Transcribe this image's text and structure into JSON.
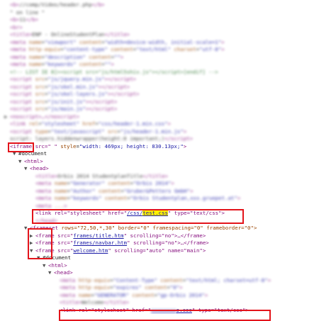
{
  "iframe": {
    "open": "<iframe src=\"",
    "src": "                         ",
    "style": "width: 469px; height: 830.13px;",
    "close": ">"
  },
  "document_label": "#document",
  "html_label": "<html>",
  "head_label": "<head>",
  "link1": {
    "prefix": "<link rel=\"stylesheet\" href=\"",
    "href_dir": "/css/",
    "href_file": "test.css",
    "suffix": "\" type=\"text/css\">"
  },
  "frameset": {
    "open": "frameset",
    "attrs": "rows=\"72,50,*,30\" border=\"0\" framespacing=\"0\" frameborder=\"0\">"
  },
  "frames": [
    {
      "prefix": "<frame src=\"",
      "href": "frames/title.htm",
      "suffix": "\" scrolling=\"no\">…</frame>"
    },
    {
      "prefix": "<frame src=\"",
      "href": "frames/navbar.htm",
      "suffix": "\" scrolling=\"no\">…</frame>"
    },
    {
      "prefix": "<frame src=\"",
      "href": "welcome.htm",
      "suffix": "\" scrolling=\"auto\" name=\"main\">"
    }
  ],
  "inner_document_label": "#document",
  "inner_html_label": "<html>",
  "inner_head_label": "<head>",
  "link2": {
    "prefix": "<link rel=\"stylesheet\" href=\"",
    "href_file": "o.css",
    "suffix": "\" type=\"text/css\">"
  }
}
